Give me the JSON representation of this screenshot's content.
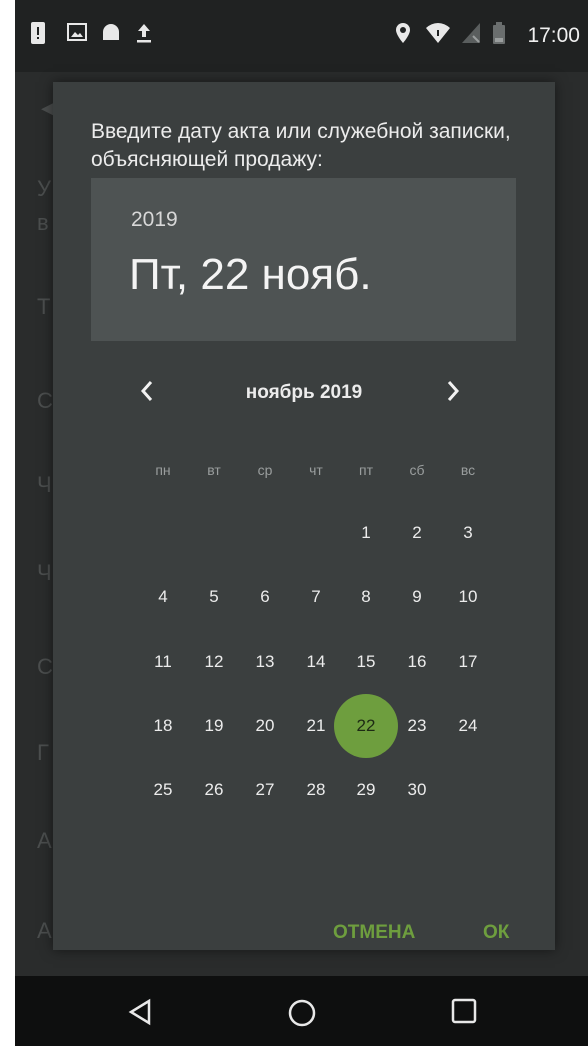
{
  "status_bar": {
    "time": "17:00",
    "icons": [
      "sim-alert-icon",
      "image-icon",
      "android-icon",
      "upload-icon",
      "location-icon",
      "wifi-icon",
      "signal-icon",
      "battery-icon"
    ]
  },
  "dialog": {
    "title": "Введите дату акта или служебной записки, объясняющей продажу:",
    "header": {
      "year": "2019",
      "date": "Пт, 22 нояб."
    },
    "month_label": "ноябрь 2019",
    "prev_icon": "chevron-left-icon",
    "next_icon": "chevron-right-icon",
    "weekdays": [
      "пн",
      "вт",
      "ср",
      "чт",
      "пт",
      "сб",
      "вс"
    ],
    "days": [
      "1",
      "2",
      "3",
      "4",
      "5",
      "6",
      "7",
      "8",
      "9",
      "10",
      "11",
      "12",
      "13",
      "14",
      "15",
      "16",
      "17",
      "18",
      "19",
      "20",
      "21",
      "22",
      "23",
      "24",
      "25",
      "26",
      "27",
      "28",
      "29",
      "30"
    ],
    "selected_day": "22",
    "accent_color": "#6e9e3e",
    "cancel_label": "ОТМЕНА",
    "ok_label": "ОК"
  },
  "nav_bar": {
    "icons": [
      "back-icon",
      "home-icon",
      "recents-icon"
    ]
  }
}
